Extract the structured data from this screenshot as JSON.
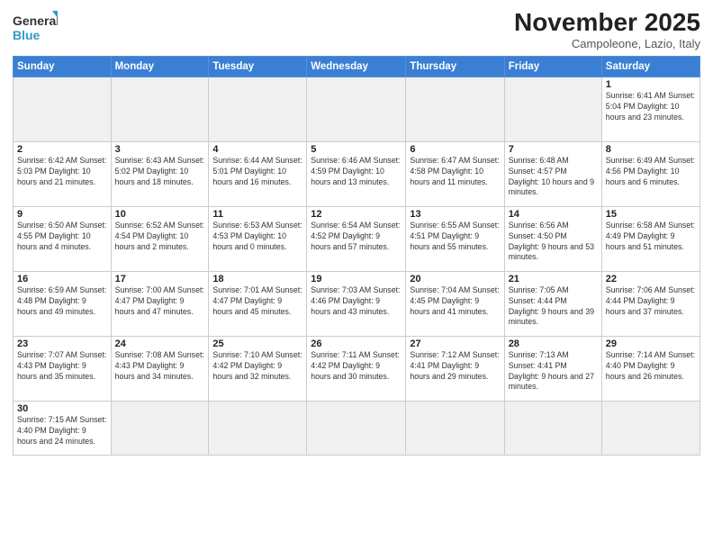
{
  "logo": {
    "text_general": "General",
    "text_blue": "Blue"
  },
  "header": {
    "month": "November 2025",
    "location": "Campoleone, Lazio, Italy"
  },
  "weekdays": [
    "Sunday",
    "Monday",
    "Tuesday",
    "Wednesday",
    "Thursday",
    "Friday",
    "Saturday"
  ],
  "weeks": [
    [
      {
        "day": "",
        "info": ""
      },
      {
        "day": "",
        "info": ""
      },
      {
        "day": "",
        "info": ""
      },
      {
        "day": "",
        "info": ""
      },
      {
        "day": "",
        "info": ""
      },
      {
        "day": "",
        "info": ""
      },
      {
        "day": "1",
        "info": "Sunrise: 6:41 AM\nSunset: 5:04 PM\nDaylight: 10 hours\nand 23 minutes."
      }
    ],
    [
      {
        "day": "2",
        "info": "Sunrise: 6:42 AM\nSunset: 5:03 PM\nDaylight: 10 hours\nand 21 minutes."
      },
      {
        "day": "3",
        "info": "Sunrise: 6:43 AM\nSunset: 5:02 PM\nDaylight: 10 hours\nand 18 minutes."
      },
      {
        "day": "4",
        "info": "Sunrise: 6:44 AM\nSunset: 5:01 PM\nDaylight: 10 hours\nand 16 minutes."
      },
      {
        "day": "5",
        "info": "Sunrise: 6:46 AM\nSunset: 4:59 PM\nDaylight: 10 hours\nand 13 minutes."
      },
      {
        "day": "6",
        "info": "Sunrise: 6:47 AM\nSunset: 4:58 PM\nDaylight: 10 hours\nand 11 minutes."
      },
      {
        "day": "7",
        "info": "Sunrise: 6:48 AM\nSunset: 4:57 PM\nDaylight: 10 hours\nand 9 minutes."
      },
      {
        "day": "8",
        "info": "Sunrise: 6:49 AM\nSunset: 4:56 PM\nDaylight: 10 hours\nand 6 minutes."
      }
    ],
    [
      {
        "day": "9",
        "info": "Sunrise: 6:50 AM\nSunset: 4:55 PM\nDaylight: 10 hours\nand 4 minutes."
      },
      {
        "day": "10",
        "info": "Sunrise: 6:52 AM\nSunset: 4:54 PM\nDaylight: 10 hours\nand 2 minutes."
      },
      {
        "day": "11",
        "info": "Sunrise: 6:53 AM\nSunset: 4:53 PM\nDaylight: 10 hours\nand 0 minutes."
      },
      {
        "day": "12",
        "info": "Sunrise: 6:54 AM\nSunset: 4:52 PM\nDaylight: 9 hours\nand 57 minutes."
      },
      {
        "day": "13",
        "info": "Sunrise: 6:55 AM\nSunset: 4:51 PM\nDaylight: 9 hours\nand 55 minutes."
      },
      {
        "day": "14",
        "info": "Sunrise: 6:56 AM\nSunset: 4:50 PM\nDaylight: 9 hours\nand 53 minutes."
      },
      {
        "day": "15",
        "info": "Sunrise: 6:58 AM\nSunset: 4:49 PM\nDaylight: 9 hours\nand 51 minutes."
      }
    ],
    [
      {
        "day": "16",
        "info": "Sunrise: 6:59 AM\nSunset: 4:48 PM\nDaylight: 9 hours\nand 49 minutes."
      },
      {
        "day": "17",
        "info": "Sunrise: 7:00 AM\nSunset: 4:47 PM\nDaylight: 9 hours\nand 47 minutes."
      },
      {
        "day": "18",
        "info": "Sunrise: 7:01 AM\nSunset: 4:47 PM\nDaylight: 9 hours\nand 45 minutes."
      },
      {
        "day": "19",
        "info": "Sunrise: 7:03 AM\nSunset: 4:46 PM\nDaylight: 9 hours\nand 43 minutes."
      },
      {
        "day": "20",
        "info": "Sunrise: 7:04 AM\nSunset: 4:45 PM\nDaylight: 9 hours\nand 41 minutes."
      },
      {
        "day": "21",
        "info": "Sunrise: 7:05 AM\nSunset: 4:44 PM\nDaylight: 9 hours\nand 39 minutes."
      },
      {
        "day": "22",
        "info": "Sunrise: 7:06 AM\nSunset: 4:44 PM\nDaylight: 9 hours\nand 37 minutes."
      }
    ],
    [
      {
        "day": "23",
        "info": "Sunrise: 7:07 AM\nSunset: 4:43 PM\nDaylight: 9 hours\nand 35 minutes."
      },
      {
        "day": "24",
        "info": "Sunrise: 7:08 AM\nSunset: 4:43 PM\nDaylight: 9 hours\nand 34 minutes."
      },
      {
        "day": "25",
        "info": "Sunrise: 7:10 AM\nSunset: 4:42 PM\nDaylight: 9 hours\nand 32 minutes."
      },
      {
        "day": "26",
        "info": "Sunrise: 7:11 AM\nSunset: 4:42 PM\nDaylight: 9 hours\nand 30 minutes."
      },
      {
        "day": "27",
        "info": "Sunrise: 7:12 AM\nSunset: 4:41 PM\nDaylight: 9 hours\nand 29 minutes."
      },
      {
        "day": "28",
        "info": "Sunrise: 7:13 AM\nSunset: 4:41 PM\nDaylight: 9 hours\nand 27 minutes."
      },
      {
        "day": "29",
        "info": "Sunrise: 7:14 AM\nSunset: 4:40 PM\nDaylight: 9 hours\nand 26 minutes."
      }
    ],
    [
      {
        "day": "30",
        "info": "Sunrise: 7:15 AM\nSunset: 4:40 PM\nDaylight: 9 hours\nand 24 minutes."
      },
      {
        "day": "",
        "info": ""
      },
      {
        "day": "",
        "info": ""
      },
      {
        "day": "",
        "info": ""
      },
      {
        "day": "",
        "info": ""
      },
      {
        "day": "",
        "info": ""
      },
      {
        "day": "",
        "info": ""
      }
    ]
  ]
}
